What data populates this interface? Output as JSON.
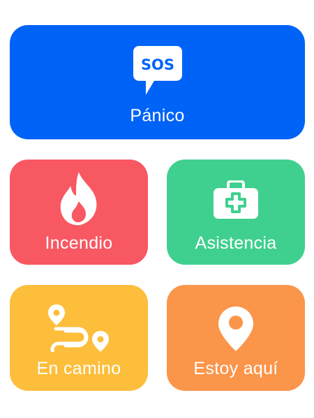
{
  "buttons": {
    "panic": {
      "label": "Pánico",
      "icon": "sos-speech-bubble-icon",
      "color": "#0063f7"
    },
    "fire": {
      "label": "Incendio",
      "icon": "flame-icon",
      "color": "#f85862"
    },
    "assist": {
      "label": "Asistencia",
      "icon": "first-aid-kit-icon",
      "color": "#3fd08f"
    },
    "onway": {
      "label": "En camino",
      "icon": "route-icon",
      "color": "#fdbe3b"
    },
    "here": {
      "label": "Estoy aquí",
      "icon": "location-pin-icon",
      "color": "#fb954a"
    }
  },
  "sos_text": "SOS"
}
